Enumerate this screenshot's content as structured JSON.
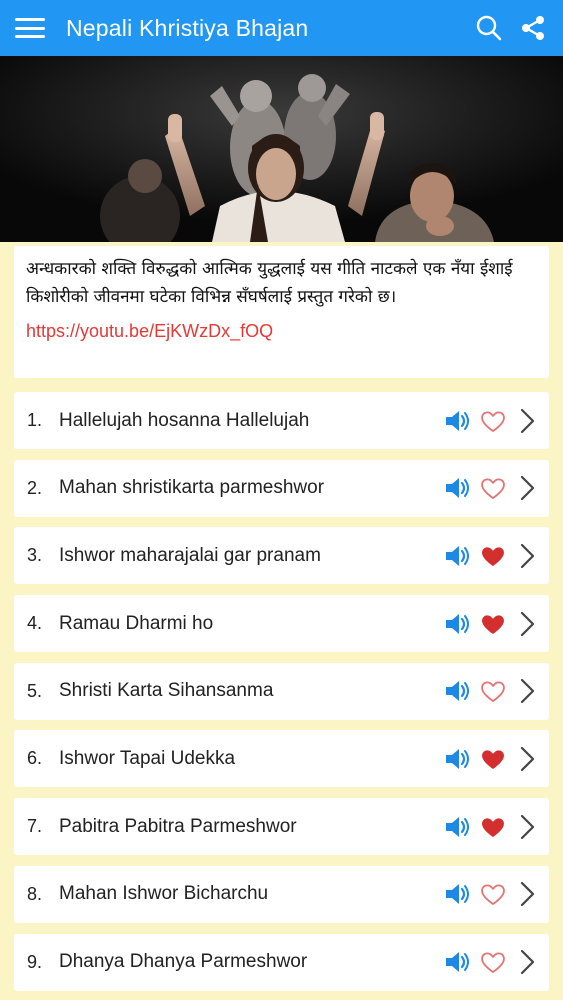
{
  "app": {
    "title": "Nepali Khristiya Bhajan"
  },
  "header": {
    "icons": [
      "menu-icon",
      "search-icon",
      "share-icon"
    ]
  },
  "description": {
    "text": "अन्धकारको शक्ति विरुद्धको आत्मिक युद्धलाई यस गीति नाटकले एक नँया ईशाई किशोरीको जीवनमा घटेका विभिन्न सँघर्षलाई प्रस्तुत गरेको छ।",
    "link": "https://youtu.be/EjKWzDx_fOQ"
  },
  "colors": {
    "appbar": "#2196f3",
    "background": "#fbf5c6",
    "link": "#e53935",
    "speaker": "#1e88e5",
    "heart": "#d32f2f"
  },
  "songs": [
    {
      "num": "1.",
      "title": "Hallelujah hosanna Hallelujah",
      "favorite": false
    },
    {
      "num": "2.",
      "title": "Mahan shristikarta parmeshwor",
      "favorite": false
    },
    {
      "num": "3.",
      "title": "Ishwor maharajalai gar pranam",
      "favorite": true
    },
    {
      "num": "4.",
      "title": "Ramau Dharmi ho",
      "favorite": true
    },
    {
      "num": "5.",
      "title": "Shristi Karta Sihansanma",
      "favorite": false
    },
    {
      "num": "6.",
      "title": "Ishwor Tapai Udekka",
      "favorite": true
    },
    {
      "num": "7.",
      "title": "Pabitra Pabitra Parmeshwor",
      "favorite": true
    },
    {
      "num": "8.",
      "title": "Mahan Ishwor Bicharchu",
      "favorite": false
    },
    {
      "num": "9.",
      "title": "Dhanya Dhanya Parmeshwor",
      "favorite": false
    }
  ]
}
